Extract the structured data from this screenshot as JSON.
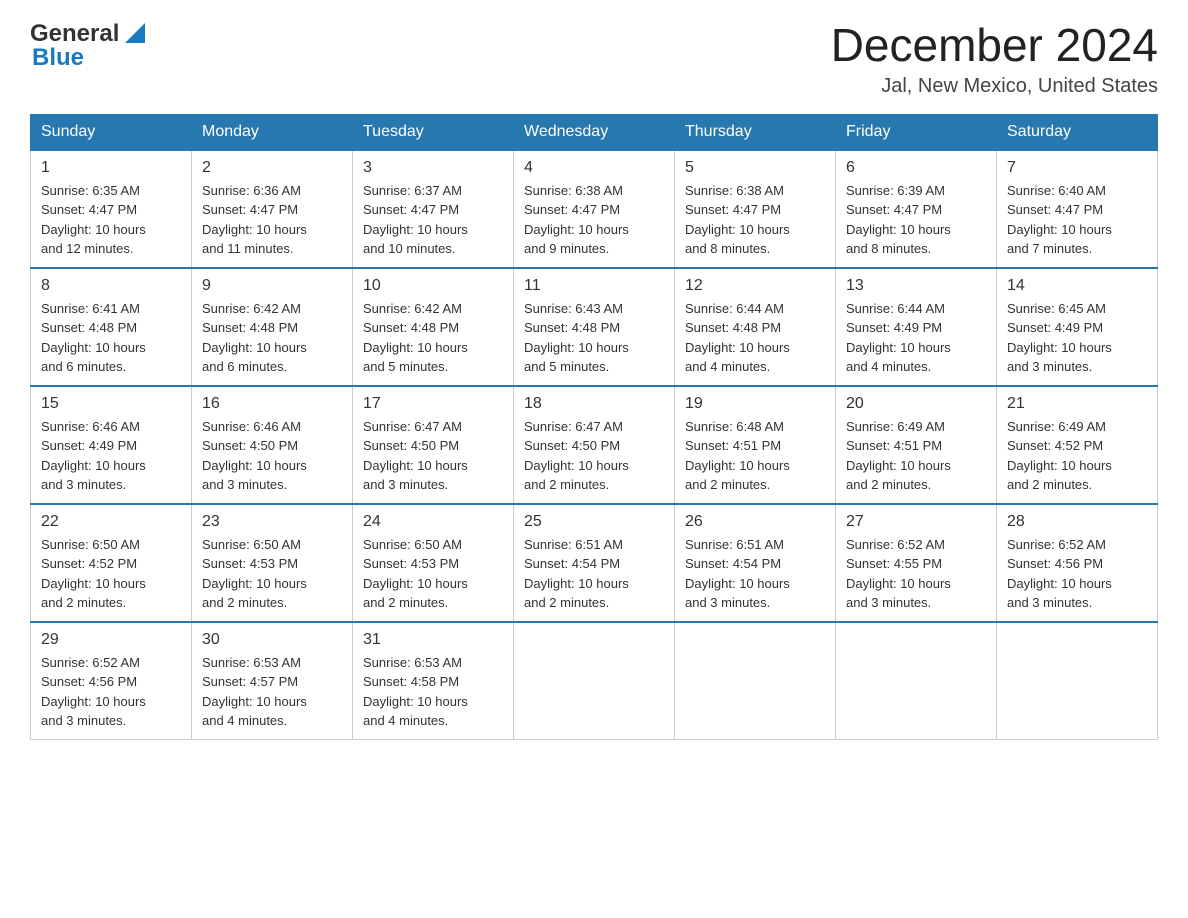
{
  "header": {
    "logo_general": "General",
    "logo_blue": "Blue",
    "month_title": "December 2024",
    "location": "Jal, New Mexico, United States"
  },
  "days_of_week": [
    "Sunday",
    "Monday",
    "Tuesday",
    "Wednesday",
    "Thursday",
    "Friday",
    "Saturday"
  ],
  "weeks": [
    [
      {
        "day": "1",
        "sunrise": "6:35 AM",
        "sunset": "4:47 PM",
        "daylight": "10 hours and 12 minutes."
      },
      {
        "day": "2",
        "sunrise": "6:36 AM",
        "sunset": "4:47 PM",
        "daylight": "10 hours and 11 minutes."
      },
      {
        "day": "3",
        "sunrise": "6:37 AM",
        "sunset": "4:47 PM",
        "daylight": "10 hours and 10 minutes."
      },
      {
        "day": "4",
        "sunrise": "6:38 AM",
        "sunset": "4:47 PM",
        "daylight": "10 hours and 9 minutes."
      },
      {
        "day": "5",
        "sunrise": "6:38 AM",
        "sunset": "4:47 PM",
        "daylight": "10 hours and 8 minutes."
      },
      {
        "day": "6",
        "sunrise": "6:39 AM",
        "sunset": "4:47 PM",
        "daylight": "10 hours and 8 minutes."
      },
      {
        "day": "7",
        "sunrise": "6:40 AM",
        "sunset": "4:47 PM",
        "daylight": "10 hours and 7 minutes."
      }
    ],
    [
      {
        "day": "8",
        "sunrise": "6:41 AM",
        "sunset": "4:48 PM",
        "daylight": "10 hours and 6 minutes."
      },
      {
        "day": "9",
        "sunrise": "6:42 AM",
        "sunset": "4:48 PM",
        "daylight": "10 hours and 6 minutes."
      },
      {
        "day": "10",
        "sunrise": "6:42 AM",
        "sunset": "4:48 PM",
        "daylight": "10 hours and 5 minutes."
      },
      {
        "day": "11",
        "sunrise": "6:43 AM",
        "sunset": "4:48 PM",
        "daylight": "10 hours and 5 minutes."
      },
      {
        "day": "12",
        "sunrise": "6:44 AM",
        "sunset": "4:48 PM",
        "daylight": "10 hours and 4 minutes."
      },
      {
        "day": "13",
        "sunrise": "6:44 AM",
        "sunset": "4:49 PM",
        "daylight": "10 hours and 4 minutes."
      },
      {
        "day": "14",
        "sunrise": "6:45 AM",
        "sunset": "4:49 PM",
        "daylight": "10 hours and 3 minutes."
      }
    ],
    [
      {
        "day": "15",
        "sunrise": "6:46 AM",
        "sunset": "4:49 PM",
        "daylight": "10 hours and 3 minutes."
      },
      {
        "day": "16",
        "sunrise": "6:46 AM",
        "sunset": "4:50 PM",
        "daylight": "10 hours and 3 minutes."
      },
      {
        "day": "17",
        "sunrise": "6:47 AM",
        "sunset": "4:50 PM",
        "daylight": "10 hours and 3 minutes."
      },
      {
        "day": "18",
        "sunrise": "6:47 AM",
        "sunset": "4:50 PM",
        "daylight": "10 hours and 2 minutes."
      },
      {
        "day": "19",
        "sunrise": "6:48 AM",
        "sunset": "4:51 PM",
        "daylight": "10 hours and 2 minutes."
      },
      {
        "day": "20",
        "sunrise": "6:49 AM",
        "sunset": "4:51 PM",
        "daylight": "10 hours and 2 minutes."
      },
      {
        "day": "21",
        "sunrise": "6:49 AM",
        "sunset": "4:52 PM",
        "daylight": "10 hours and 2 minutes."
      }
    ],
    [
      {
        "day": "22",
        "sunrise": "6:50 AM",
        "sunset": "4:52 PM",
        "daylight": "10 hours and 2 minutes."
      },
      {
        "day": "23",
        "sunrise": "6:50 AM",
        "sunset": "4:53 PM",
        "daylight": "10 hours and 2 minutes."
      },
      {
        "day": "24",
        "sunrise": "6:50 AM",
        "sunset": "4:53 PM",
        "daylight": "10 hours and 2 minutes."
      },
      {
        "day": "25",
        "sunrise": "6:51 AM",
        "sunset": "4:54 PM",
        "daylight": "10 hours and 2 minutes."
      },
      {
        "day": "26",
        "sunrise": "6:51 AM",
        "sunset": "4:54 PM",
        "daylight": "10 hours and 3 minutes."
      },
      {
        "day": "27",
        "sunrise": "6:52 AM",
        "sunset": "4:55 PM",
        "daylight": "10 hours and 3 minutes."
      },
      {
        "day": "28",
        "sunrise": "6:52 AM",
        "sunset": "4:56 PM",
        "daylight": "10 hours and 3 minutes."
      }
    ],
    [
      {
        "day": "29",
        "sunrise": "6:52 AM",
        "sunset": "4:56 PM",
        "daylight": "10 hours and 3 minutes."
      },
      {
        "day": "30",
        "sunrise": "6:53 AM",
        "sunset": "4:57 PM",
        "daylight": "10 hours and 4 minutes."
      },
      {
        "day": "31",
        "sunrise": "6:53 AM",
        "sunset": "4:58 PM",
        "daylight": "10 hours and 4 minutes."
      },
      null,
      null,
      null,
      null
    ]
  ],
  "labels": {
    "sunrise": "Sunrise:",
    "sunset": "Sunset:",
    "daylight": "Daylight:"
  }
}
